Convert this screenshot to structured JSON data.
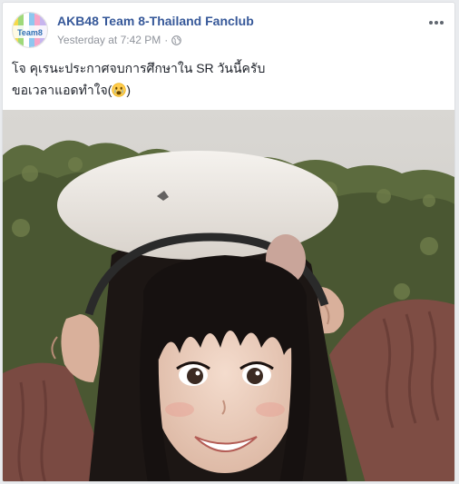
{
  "post": {
    "page_name": "AKB48 Team 8-Thailand Fanclub",
    "timestamp": "Yesterday at 7:42 PM",
    "separator": "·",
    "privacy_icon": "globe-icon",
    "more_icon": "more-options-icon",
    "avatar_text": "Team 8",
    "text_line1": "โจ คุเรนะประกาศจบการศึกษาใน SR วันนี้ครับ",
    "text_line2_prefix": "ขอเวลาแอดทำใจ(",
    "text_line2_emoji": "crying-face-emoji",
    "text_line2_suffix": ")"
  },
  "colors": {
    "page_name": "#365899",
    "meta_text": "#90949c",
    "body_text": "#1d2129",
    "background": "#e9ebee"
  }
}
